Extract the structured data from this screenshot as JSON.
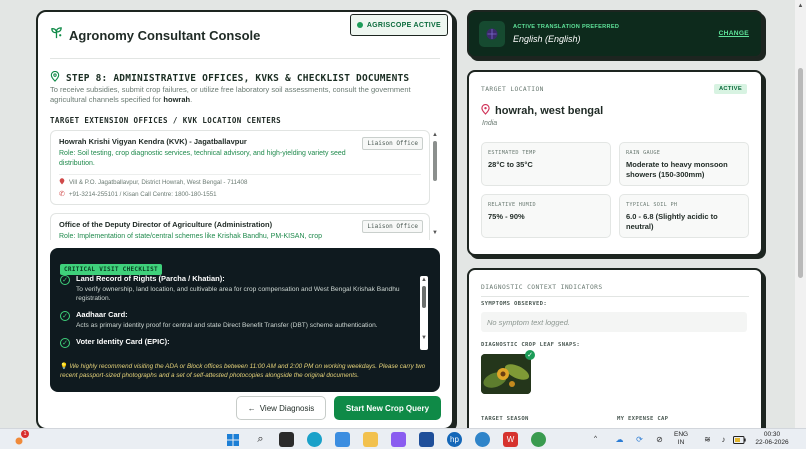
{
  "console": {
    "title": "Agronomy Consultant Console",
    "badge": "AGRISCOPE ACTIVE"
  },
  "step": {
    "title": "STEP 8: ADMINISTRATIVE OFFICES, KVKS & CHECKLIST DOCUMENTS",
    "desc_prefix": "To receive subsidies, submit crop failures, or utilize free laboratory soil assessments, consult the government agricultural channels specified for ",
    "desc_location": "howrah",
    "desc_suffix": "."
  },
  "offices_heading": "TARGET EXTENSION OFFICES / KVK LOCATION CENTERS",
  "offices": [
    {
      "name": "Howrah Krishi Vigyan Kendra (KVK) - Jagatballavpur",
      "role": "Role: Soil testing, crop diagnostic services, technical advisory, and high-yielding variety seed distribution.",
      "address": "Vill & P.O. Jagatballavpur, District Howrah, West Bengal - 711408",
      "phone": "+91-3214-255101 / Kisan Call Centre: 1800-180-1551",
      "tag": "Liaison Office"
    },
    {
      "name": "Office of the Deputy Director of Agriculture (Administration)",
      "role": "Role: Implementation of state/central schemes like Krishak Bandhu, PM-KISAN, crop",
      "tag": "Liaison Office"
    }
  ],
  "checklist": {
    "badge": "CRITICAL VISIT CHECKLIST",
    "items": [
      {
        "title": "Land Record of Rights (Parcha / Khatian):",
        "text": "To verify ownership, land location, and cultivable area for crop compensation and West Bengal Krishak Bandhu registration."
      },
      {
        "title": "Aadhaar Card:",
        "text": "Acts as primary identity proof for central and state Direct Benefit Transfer (DBT) scheme authentication."
      },
      {
        "title": "Voter Identity Card (EPIC):",
        "text": ""
      }
    ],
    "note": "We highly recommend visiting the ADA or Block offices between 11:00 AM and 2:00 PM on working weekdays. Please carry two recent passport-sized photographs and a set of self-attested photocopies alongside the original documents."
  },
  "buttons": {
    "back": "View Diagnosis",
    "new": "Start New Crop Query"
  },
  "translation": {
    "label": "ACTIVE TRANSLATION PREFERRED",
    "value": "English (English)",
    "change": "CHANGE"
  },
  "location": {
    "label": "TARGET LOCATION",
    "status": "ACTIVE",
    "name": "howrah, west bengal",
    "country": "India",
    "metrics": [
      {
        "label": "ESTIMATED TEMP",
        "value": "28°C to 35°C"
      },
      {
        "label": "RAIN GAUGE",
        "value": "Moderate to heavy monsoon showers (150-300mm)"
      },
      {
        "label": "RELATIVE HUMID",
        "value": "75% - 90%"
      },
      {
        "label": "TYPICAL SOIL PH",
        "value": "6.0 - 6.8 (Slightly acidic to neutral)"
      }
    ]
  },
  "diagnostic": {
    "label": "DIAGNOSTIC CONTEXT INDICATORS",
    "symptoms_label": "SYMPTOMS OBSERVED:",
    "symptoms_value": "No symptom text logged.",
    "snaps_label": "DIAGNOSTIC CROP LEAF SNAPS:",
    "season_label": "TARGET SEASON",
    "expense_label": "MY EXPENSE CAP"
  },
  "taskbar": {
    "notification_count": "1",
    "lang_top": "ENG",
    "lang_bottom": "IN",
    "time": "00:30",
    "date": "22-06-2026"
  },
  "colors": {
    "accent_green": "#0f8a47",
    "dark_panel": "#0f1a1f",
    "translation_bg": "#0d2a1c",
    "highlight_green": "#3fd17b",
    "note_yellow": "#e6d37a"
  }
}
